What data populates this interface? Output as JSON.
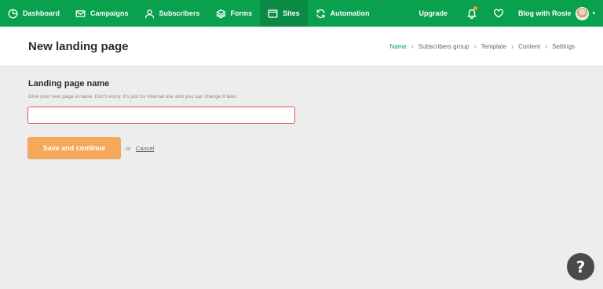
{
  "nav": {
    "items": [
      {
        "label": "Dashboard",
        "icon": "dashboard-icon"
      },
      {
        "label": "Campaigns",
        "icon": "envelope-icon"
      },
      {
        "label": "Subscribers",
        "icon": "user-icon"
      },
      {
        "label": "Forms",
        "icon": "layers-icon"
      },
      {
        "label": "Sites",
        "icon": "browser-window-icon",
        "active": true
      },
      {
        "label": "Automation",
        "icon": "refresh-icon"
      }
    ],
    "upgrade_label": "Upgrade",
    "account_name": "Blog with Rosie",
    "notification_dot_color": "#f59e36"
  },
  "header": {
    "title": "New landing page",
    "breadcrumb": [
      "Name",
      "Subscribers group",
      "Template",
      "Content",
      "Settings"
    ],
    "active_step": "Name"
  },
  "form": {
    "label": "Landing page name",
    "help": "Give your new page a name. Don't worry, it's just for internal use and you can change it later.",
    "input_value": "",
    "input_placeholder": "",
    "save_label": "Save and continue",
    "or_text": "or",
    "cancel_label": "Cancel"
  },
  "help_button": {
    "label": "?"
  },
  "colors": {
    "brand_green": "#09a04e",
    "active_nav": "#0a8a45",
    "save_button": "#f5a85a",
    "input_error_border": "#e2574c",
    "background": "#ededed"
  }
}
